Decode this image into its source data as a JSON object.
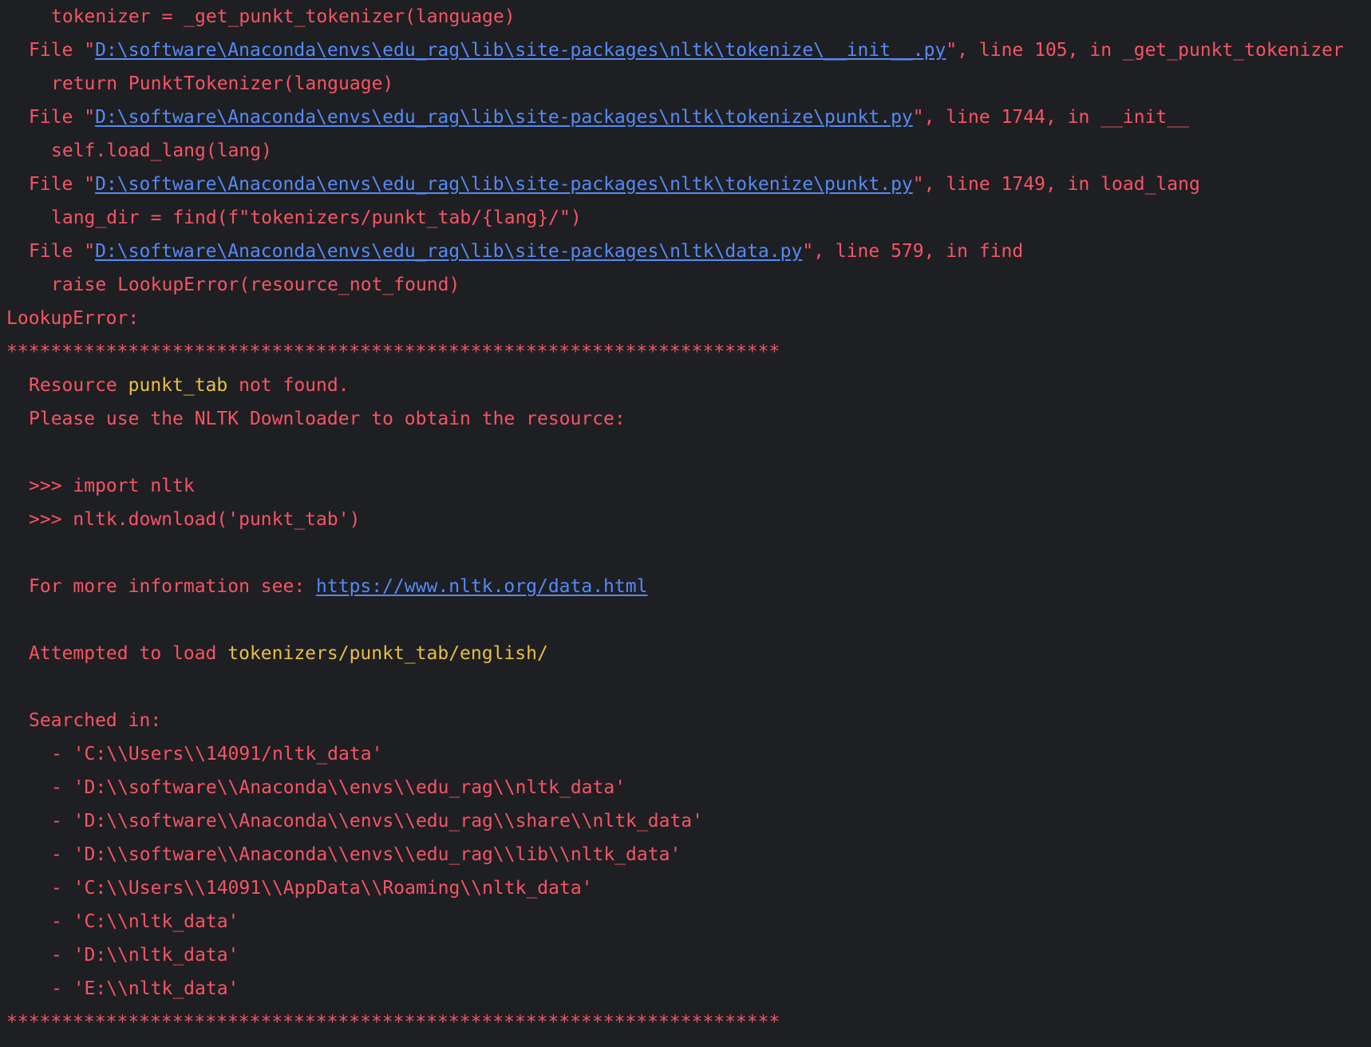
{
  "trace": [
    {
      "kind": "code",
      "text": "tokenizer = _get_punkt_tokenizer(language)"
    },
    {
      "kind": "file",
      "pre": "File \"",
      "link": "D:\\software\\Anaconda\\envs\\edu_rag\\lib\\site-packages\\nltk\\tokenize\\__init__.py",
      "post": "\", line 105, in _get_punkt_tokenizer"
    },
    {
      "kind": "code",
      "text": "return PunktTokenizer(language)"
    },
    {
      "kind": "file",
      "pre": "File \"",
      "link": "D:\\software\\Anaconda\\envs\\edu_rag\\lib\\site-packages\\nltk\\tokenize\\punkt.py",
      "post": "\", line 1744, in __init__"
    },
    {
      "kind": "code",
      "text": "self.load_lang(lang)"
    },
    {
      "kind": "file",
      "pre": "File \"",
      "link": "D:\\software\\Anaconda\\envs\\edu_rag\\lib\\site-packages\\nltk\\tokenize\\punkt.py",
      "post": "\", line 1749, in load_lang"
    },
    {
      "kind": "code",
      "text": "lang_dir = find(f\"tokenizers/punkt_tab/{lang}/\")"
    },
    {
      "kind": "file",
      "pre": "File \"",
      "link": "D:\\software\\Anaconda\\envs\\edu_rag\\lib\\site-packages\\nltk\\data.py",
      "post": "\", line 579, in find"
    },
    {
      "kind": "code",
      "text": "raise LookupError(resource_not_found)"
    }
  ],
  "error": {
    "title": "LookupError:",
    "stars": "**********************************************************************",
    "resource_pre": "Resource ",
    "resource_name": "punkt_tab",
    "resource_post": " not found.",
    "please": "Please use the NLTK Downloader to obtain the resource:",
    "cmd1": ">>> import nltk",
    "cmd2": ">>> nltk.download('punkt_tab')",
    "info_pre": "For more information see: ",
    "info_link": "https://www.nltk.org/data.html",
    "attempt_pre": "Attempted to load ",
    "attempt_path": "tokenizers/punkt_tab/english/",
    "searched": "Searched in:",
    "paths": [
      "- 'C:\\\\Users\\\\14091/nltk_data'",
      "- 'D:\\\\software\\\\Anaconda\\\\envs\\\\edu_rag\\\\nltk_data'",
      "- 'D:\\\\software\\\\Anaconda\\\\envs\\\\edu_rag\\\\share\\\\nltk_data'",
      "- 'D:\\\\software\\\\Anaconda\\\\envs\\\\edu_rag\\\\lib\\\\nltk_data'",
      "- 'C:\\\\Users\\\\14091\\\\AppData\\\\Roaming\\\\nltk_data'",
      "- 'C:\\\\nltk_data'",
      "- 'D:\\\\nltk_data'",
      "- 'E:\\\\nltk_data'"
    ]
  },
  "colors": {
    "background": "#1e1f22",
    "error_text": "#f75464",
    "link": "#548af7",
    "highlight": "#e8bf45"
  }
}
